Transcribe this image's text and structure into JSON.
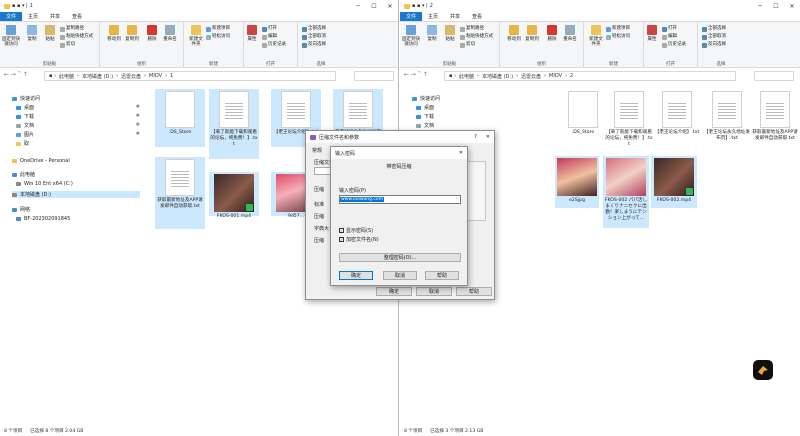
{
  "left": {
    "title": "1",
    "tabs": [
      "文件",
      "主页",
      "共享",
      "查看"
    ],
    "ribbon": {
      "pin_quick": "固定到快速访问",
      "copy": "复制",
      "paste": "粘贴",
      "copy_path": "复制路径",
      "paste_shortcut": "粘贴快捷方式",
      "cut": "剪切",
      "clipboard": "剪贴板",
      "move_to": "移动到",
      "copy_to": "复制到",
      "delete": "删除",
      "rename": "重命名",
      "organize": "组织",
      "new_folder": "新建文件夹",
      "new_item": "新建项目",
      "easy_access": "轻松访问",
      "new": "新建",
      "properties": "属性",
      "open": "打开",
      "edit": "编辑",
      "history": "历史记录",
      "open_group": "打开",
      "select_all": "全部选择",
      "select_none": "全部取消",
      "invert": "反向选择",
      "select": "选择"
    },
    "address": [
      "此电脑",
      "本地磁盘 (D:)",
      "迅雷云盘",
      "MIDV",
      "1"
    ],
    "nav": {
      "quick": "快速访问",
      "desktop": "桌面",
      "downloads": "下载",
      "documents": "文档",
      "pictures": "图片",
      "other": "取",
      "onedrive": "OneDrive - Personal",
      "thispc": "此电脑",
      "win10": "Win 10 Ent x64 (C:)",
      "local_d": "本地磁盘 (D:)",
      "network": "网络",
      "bf": "BF-202302091845"
    },
    "files": [
      {
        "name": ".DS_Store"
      },
      {
        "name": "【来了就能下载和观看的论坛，纯免费！】.txt"
      },
      {
        "name": "【老王论坛介绍】.txt"
      },
      {
        "name": "老王论坛永久地址发布页】.txt"
      },
      {
        "name": "获取最新地址及APP请发邮件自动获取.txt"
      },
      {
        "name": "FKOS-001.mp4"
      },
      {
        "name": "9d57..."
      }
    ],
    "status": {
      "count": "8 个项目",
      "selected": "已选择 8 个项目 2.04 GB"
    }
  },
  "right": {
    "title": "2",
    "address": [
      "此电脑",
      "本地磁盘 (D:)",
      "迅雷云盘",
      "MIDV",
      "2"
    ],
    "nav": {
      "quick": "快速访问"
    },
    "files": [
      {
        "name": ".DS_Store"
      },
      {
        "name": "【来了就能下载和观看的论坛，纯免费！】.txt"
      },
      {
        "name": "【老王论坛介绍】.txt"
      },
      {
        "name": "【老王论坛永久地址发布页】.txt"
      },
      {
        "name": "获取最新地址及APP请发邮件自动获取.txt"
      },
      {
        "name": "e2Sjpg"
      },
      {
        "name": "FKOS-002 パパ活しまくりナニセクに出勤！楽しまうにテンション上がって..."
      },
      {
        "name": "FKOS-002.mp4"
      }
    ],
    "status": {
      "count": "8 个项目",
      "selected": "已选择 3 个项目 2.13 GB"
    }
  },
  "archive_dialog": {
    "title": "压缩文件名和参数",
    "tab": "常规",
    "labels": [
      "压缩文件",
      "压缩",
      "标准",
      "压缩",
      "字典大",
      "压缩"
    ],
    "ok": "确定",
    "cancel": "取消",
    "help": "帮助"
  },
  "password_dialog": {
    "title": "输入密码",
    "subtitle": "带密码压缩",
    "input_label": "输入密码(P)",
    "password_value": "www.laowang.com",
    "show_password": "显示密码(S)",
    "encrypt_names": "加密文件名(N)",
    "manage": "整理密码(O)...",
    "ok": "确定",
    "cancel": "取消",
    "help": "帮助"
  }
}
